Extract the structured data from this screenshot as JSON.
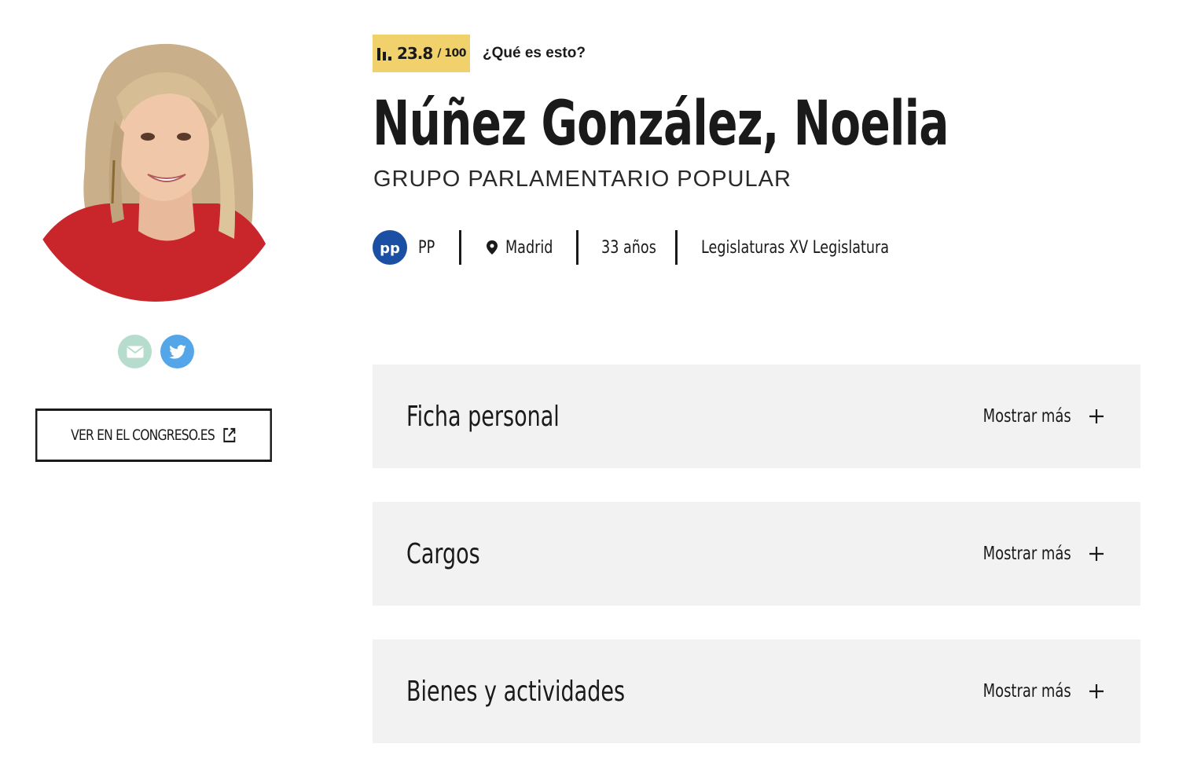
{
  "profile": {
    "photo_alt": "Núñez González, Noelia",
    "social": {
      "email_icon": "mail-icon",
      "twitter_icon": "twitter-icon"
    },
    "congreso_button_label": "VER EN EL CONGRESO.ES",
    "congreso_button_icon": "external-link-icon"
  },
  "score": {
    "icon": "bar-chart-icon",
    "value": "23.8",
    "total": "/ 100",
    "help_link": "¿Qué es esto?"
  },
  "header": {
    "name": "Núñez González, Noelia",
    "group": "GRUPO PARLAMENTARIO POPULAR"
  },
  "meta": {
    "party_logo_text": "pp",
    "party": "PP",
    "location_icon": "map-pin-icon",
    "location": "Madrid",
    "age": "33 años",
    "legislatures": "Legislaturas XV Legislatura"
  },
  "sections": [
    {
      "title": "Ficha personal",
      "action": "Mostrar más",
      "icon": "plus-icon"
    },
    {
      "title": "Cargos",
      "action": "Mostrar más",
      "icon": "plus-icon"
    },
    {
      "title": "Bienes y actividades",
      "action": "Mostrar más",
      "icon": "plus-icon"
    }
  ],
  "colors": {
    "score_badge": "#f1d16c",
    "email_button": "#b6dccd",
    "twitter_button": "#55a6e8",
    "party_blue": "#1a4fa3",
    "section_bg": "#f2f2f2",
    "text": "#1a1a1a"
  }
}
